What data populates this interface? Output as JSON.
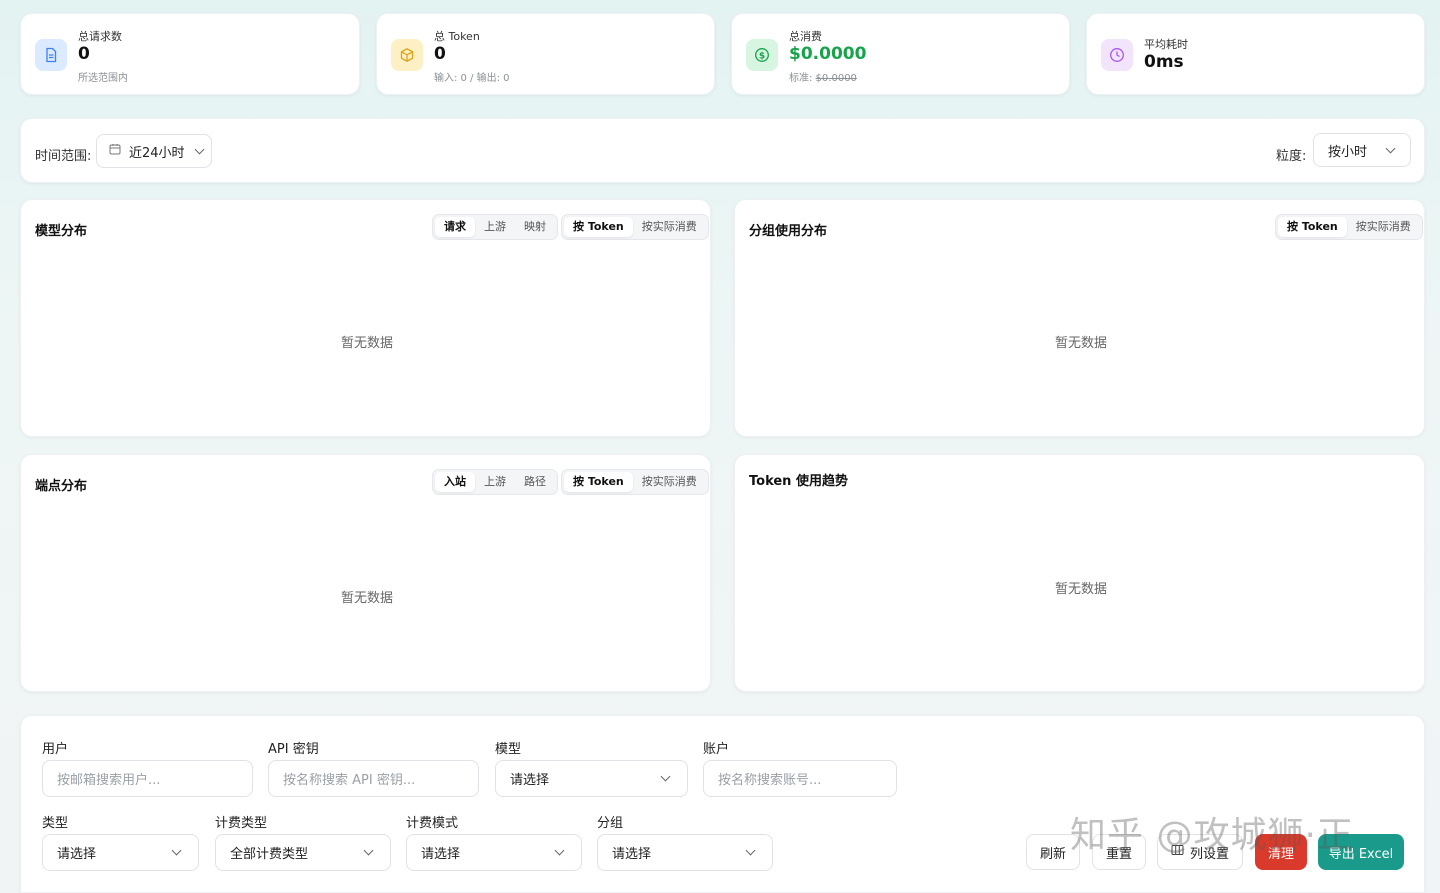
{
  "stats": [
    {
      "label": "总请求数",
      "value": "0",
      "sub": "所选范围内",
      "icon": "document-icon",
      "color": "#3b82f6"
    },
    {
      "label": "总 Token",
      "value": "0",
      "sub": "输入: 0 / 输出: 0",
      "icon": "cube-icon",
      "color": "#e0a21a"
    },
    {
      "label": "总消费",
      "value": "$0.0000",
      "sub_prefix": "标准: ",
      "sub_strike": "$0.0000",
      "icon": "dollar-icon",
      "color": "#16a34a"
    },
    {
      "label": "平均耗时",
      "value": "0ms",
      "icon": "clock-icon",
      "color": "#a855f7"
    }
  ],
  "filter": {
    "range_label": "时间范围:",
    "range_value": "近24小时",
    "granularity_label": "粒度:",
    "granularity_value": "按小时"
  },
  "charts": {
    "model": {
      "title": "模型分布",
      "seg1": [
        "请求",
        "上游",
        "映射"
      ],
      "seg2": [
        "按 Token",
        "按实际消费"
      ],
      "empty": "暂无数据"
    },
    "group": {
      "title": "分组使用分布",
      "seg2": [
        "按 Token",
        "按实际消费"
      ],
      "empty": "暂无数据"
    },
    "endpoint": {
      "title": "端点分布",
      "seg1": [
        "入站",
        "上游",
        "路径"
      ],
      "seg2": [
        "按 Token",
        "按实际消费"
      ],
      "empty": "暂无数据"
    },
    "trend": {
      "title": "Token 使用趋势",
      "empty": "暂无数据"
    }
  },
  "form": {
    "user": {
      "label": "用户",
      "placeholder": "按邮箱搜索用户..."
    },
    "apikey": {
      "label": "API 密钥",
      "placeholder": "按名称搜索 API 密钥..."
    },
    "model": {
      "label": "模型",
      "value": "请选择"
    },
    "account": {
      "label": "账户",
      "placeholder": "按名称搜索账号..."
    },
    "type": {
      "label": "类型",
      "value": "请选择"
    },
    "billing_type": {
      "label": "计费类型",
      "value": "全部计费类型"
    },
    "billing_mode": {
      "label": "计费模式",
      "value": "请选择"
    },
    "group": {
      "label": "分组",
      "value": "请选择"
    }
  },
  "buttons": {
    "refresh": "刷新",
    "reset": "重置",
    "columns": "列设置",
    "clear": "清理",
    "export": "导出 Excel"
  },
  "watermark": "知乎 @攻城狮·正"
}
